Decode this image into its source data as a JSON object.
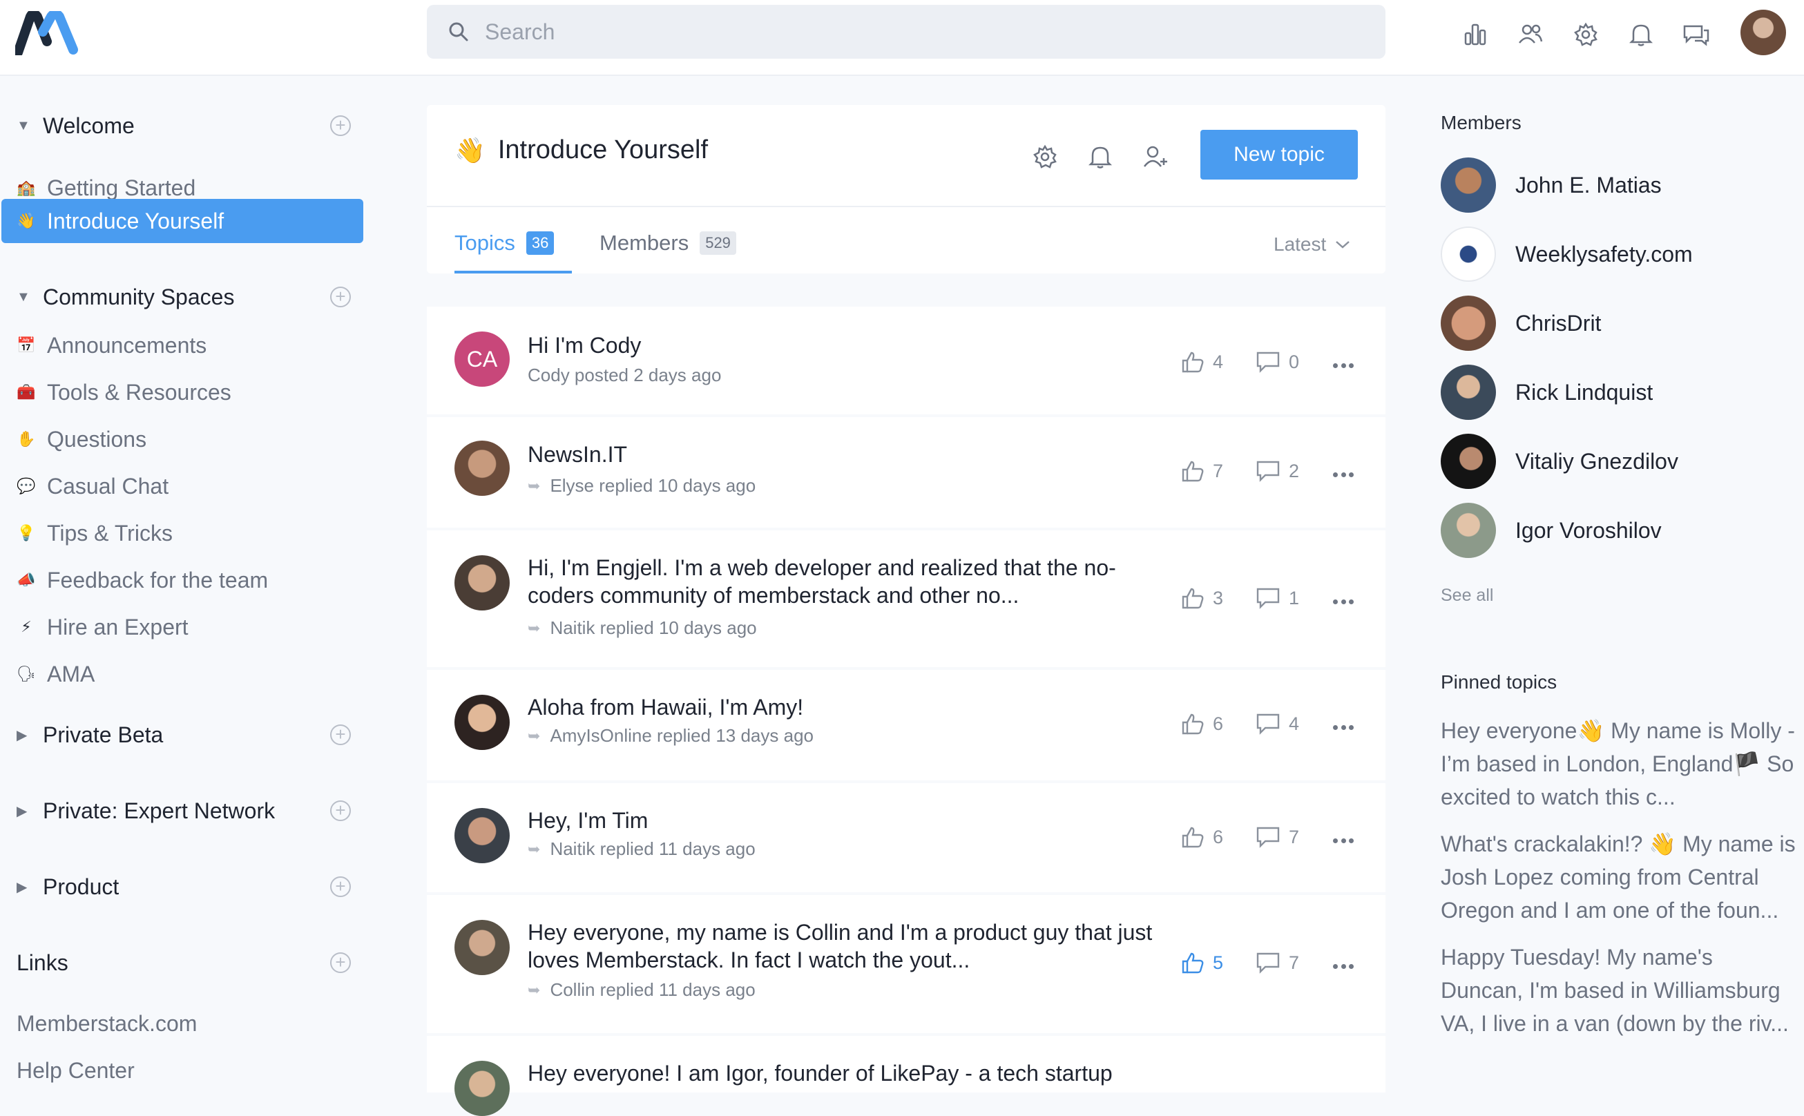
{
  "search": {
    "placeholder": "Search"
  },
  "top_icons": [
    "analytics-icon",
    "users-icon",
    "settings-icon",
    "bell-icon",
    "chat-icon"
  ],
  "sidebar": {
    "sections": [
      {
        "label": "Welcome",
        "expanded": true
      },
      {
        "label": "Community Spaces",
        "expanded": true
      },
      {
        "label": "Private Beta",
        "expanded": false
      },
      {
        "label": "Private: Expert Network",
        "expanded": false
      },
      {
        "label": "Product",
        "expanded": false
      },
      {
        "label": "Links"
      }
    ],
    "welcome_items": [
      {
        "emoji": "🏫",
        "label": "Getting Started"
      },
      {
        "emoji": "👋",
        "label": "Introduce Yourself",
        "active": true
      }
    ],
    "community_items": [
      {
        "emoji": "📅",
        "label": "Announcements"
      },
      {
        "emoji": "🧰",
        "label": "Tools & Resources"
      },
      {
        "emoji": "✋",
        "label": "Questions"
      },
      {
        "emoji": "💬",
        "label": "Casual Chat"
      },
      {
        "emoji": "💡",
        "label": "Tips & Tricks"
      },
      {
        "emoji": "📣",
        "label": "Feedback for the team"
      },
      {
        "emoji": "⚡",
        "label": "Hire an Expert"
      },
      {
        "emoji": "🗣",
        "label": "AMA"
      }
    ],
    "links": [
      "Memberstack.com",
      "Help Center"
    ]
  },
  "space": {
    "emoji": "👋",
    "title": "Introduce Yourself",
    "new_topic_label": "New topic",
    "tabs": [
      {
        "label": "Topics",
        "count": "36"
      },
      {
        "label": "Members",
        "count": "529"
      }
    ],
    "sort_label": "Latest"
  },
  "topics": [
    {
      "title": "Hi I'm Cody",
      "meta": "Cody posted 2 days ago",
      "initials": "CA",
      "likes": "4",
      "comments": "0",
      "reply": false
    },
    {
      "title": "NewsIn.IT",
      "meta": "Elyse replied 10 days ago",
      "likes": "7",
      "comments": "2",
      "reply": true
    },
    {
      "title": "Hi, I'm Engjell. I'm a web developer and realized that the no-coders community of memberstack and other no...",
      "meta": "Naitik replied 10 days ago",
      "likes": "3",
      "comments": "1",
      "reply": true
    },
    {
      "title": "Aloha from Hawaii, I'm Amy!",
      "meta": "AmyIsOnline replied 13 days ago",
      "likes": "6",
      "comments": "4",
      "reply": true
    },
    {
      "title": "Hey, I'm Tim",
      "meta": "Naitik replied 11 days ago",
      "likes": "6",
      "comments": "7",
      "reply": true
    },
    {
      "title": "Hey everyone, my name is Collin and I'm a product guy that just loves Memberstack. In fact I watch the yout...",
      "meta": "Collin replied 11 days ago",
      "likes": "5",
      "comments": "7",
      "reply": true,
      "liked": true
    },
    {
      "title": "Hey everyone! I am Igor, founder of LikePay - a tech startup"
    }
  ],
  "right": {
    "members_heading": "Members",
    "members": [
      "John E. Matias",
      "Weeklysafety.com",
      "ChrisDrit",
      "Rick Lindquist",
      "Vitaliy Gnezdilov",
      "Igor Voroshilov"
    ],
    "see_all": "See all",
    "pinned_heading": "Pinned topics",
    "pinned": [
      "Hey everyone👋 My name is Molly - I’m based in London, England🏴 So excited to watch this c...",
      "What's crackalakin!? 👋 My name is Josh Lopez coming from Central Oregon and I am one of the foun...",
      "Happy Tuesday! My name's Duncan, I'm based in Williamsburg VA, I live in a van (down by the riv..."
    ]
  },
  "colors": {
    "accent": "#4a9cf0",
    "avatar_initials_bg": "#c8477a"
  }
}
